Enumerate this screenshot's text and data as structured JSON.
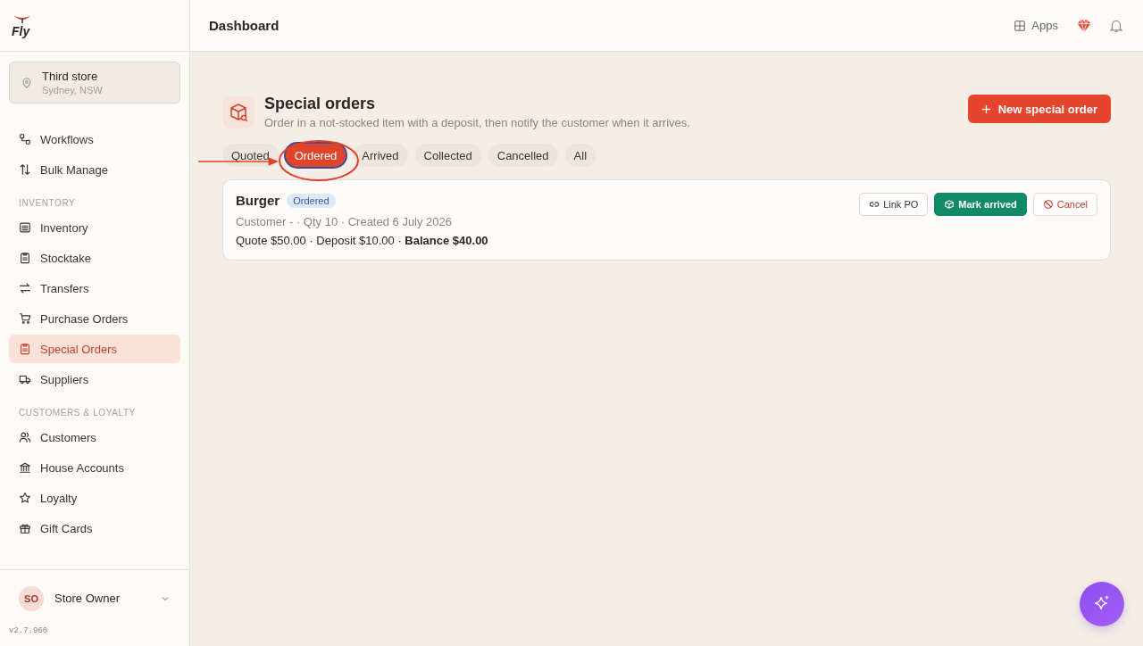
{
  "logo": {
    "text": "Fly"
  },
  "store": {
    "name": "Third store",
    "location": "Sydney, NSW"
  },
  "sidebar": {
    "sections": [
      {
        "items": [
          {
            "label": "Workflows",
            "selected": false
          },
          {
            "label": "Bulk Manage",
            "selected": false
          }
        ]
      },
      {
        "heading": "INVENTORY",
        "items": [
          {
            "label": "Inventory",
            "selected": false
          },
          {
            "label": "Stocktake",
            "selected": false
          },
          {
            "label": "Transfers",
            "selected": false
          },
          {
            "label": "Purchase Orders",
            "selected": false
          },
          {
            "label": "Special Orders",
            "selected": true
          },
          {
            "label": "Suppliers",
            "selected": false
          }
        ]
      },
      {
        "heading": "CUSTOMERS & LOYALTY",
        "items": [
          {
            "label": "Customers",
            "selected": false
          },
          {
            "label": "House Accounts",
            "selected": false
          },
          {
            "label": "Loyalty",
            "selected": false
          },
          {
            "label": "Gift Cards",
            "selected": false
          }
        ]
      }
    ]
  },
  "user": {
    "initials": "SO",
    "name": "Store Owner"
  },
  "version": "v2.7.960",
  "header": {
    "title": "Dashboard",
    "apps": "Apps"
  },
  "page": {
    "title": "Special orders",
    "description": "Order in a not-stocked item with a deposit, then notify the customer when it arrives.",
    "new_button": "New special order"
  },
  "tabs": [
    {
      "label": "Quoted",
      "selected": false
    },
    {
      "label": "Ordered",
      "selected": true
    },
    {
      "label": "Arrived",
      "selected": false
    },
    {
      "label": "Collected",
      "selected": false
    },
    {
      "label": "Cancelled",
      "selected": false
    },
    {
      "label": "All",
      "selected": false
    }
  ],
  "orders": [
    {
      "name": "Burger",
      "status": "Ordered",
      "meta": "Customer - · Qty 10 · Created 6 July 2026",
      "amounts": "Quote $50.00 · Deposit $10.00 · **Balance $40.00**",
      "actions": [
        {
          "kind": "link",
          "label": "Link PO"
        },
        {
          "kind": "primary",
          "label": "Mark arrived"
        },
        {
          "kind": "danger",
          "label": "Cancel"
        }
      ]
    }
  ]
}
